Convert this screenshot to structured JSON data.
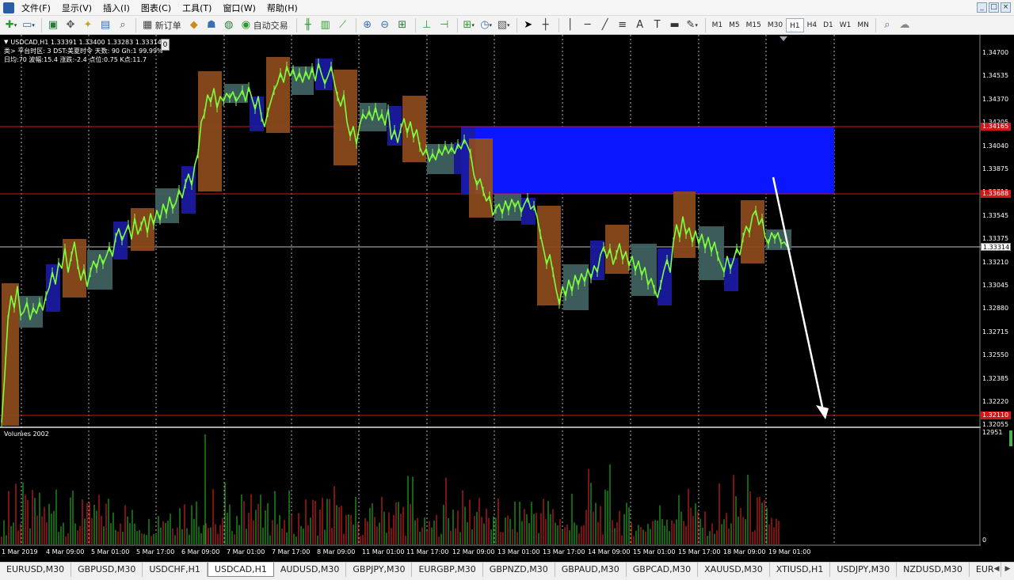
{
  "menu": {
    "items": [
      "文件(F)",
      "显示(V)",
      "插入(I)",
      "图表(C)",
      "工具(T)",
      "窗口(W)",
      "帮助(H)"
    ]
  },
  "window_controls": {
    "minimize": "_",
    "restore": "□",
    "close": "×"
  },
  "toolbar": {
    "new_order_label": "新订单",
    "auto_trade_label": "自动交易",
    "timeframes": [
      "M1",
      "M5",
      "M15",
      "M30",
      "H1",
      "H4",
      "D1",
      "W1",
      "MN"
    ],
    "active_timeframe": "H1"
  },
  "chart": {
    "symbol_line": "USDCAD,H1  1.33391 1.33400 1.33283 1.33314",
    "info_line1": "类> 平台时区: 3  DST:美夏时令  天数: 90  Gh:1  99.99%",
    "info_line2": "日均:70  波幅:15.4  涨跌:-2.4  点位:0.75  K点:11.7",
    "badge": "0",
    "volumes_label": "Volumes 2002",
    "volumes_max": "12951",
    "volumes_zero": "0",
    "price_ticks": [
      "1.34700",
      "1.34535",
      "1.34370",
      "1.34205",
      "1.34040",
      "1.33875",
      "1.33710",
      "1.33545",
      "1.33375",
      "1.33210",
      "1.33045",
      "1.32880",
      "1.32715",
      "1.32550",
      "1.32385",
      "1.32220",
      "1.32055"
    ],
    "price_markers": {
      "upper_zone": "1.34165",
      "lower_zone": "1.33688",
      "current": "1.33314",
      "target": "1.32110"
    },
    "colors": {
      "background": "#000000",
      "candles": "#7cff3c",
      "zone_fill": "#0a16ff",
      "hline": "#d01818",
      "current_line": "#bfbfbf",
      "arrow": "#ffffff",
      "box_up": "#8a4a1c",
      "box_down": "#3f6060",
      "box_blue": "#1a1aa0"
    }
  },
  "time_labels": [
    "1 Mar 2019",
    "4 Mar 09:00",
    "5 Mar 01:00",
    "5 Mar 17:00",
    "6 Mar 09:00",
    "7 Mar 01:00",
    "7 Mar 17:00",
    "8 Mar 09:00",
    "11 Mar 01:00",
    "11 Mar 17:00",
    "12 Mar 09:00",
    "13 Mar 01:00",
    "13 Mar 17:00",
    "14 Mar 09:00",
    "15 Mar 01:00",
    "15 Mar 17:00",
    "18 Mar 09:00",
    "19 Mar 01:00"
  ],
  "tabs": [
    "EURUSD,M30",
    "GBPUSD,M30",
    "USDCHF,H1",
    "USDCAD,H1",
    "AUDUSD,M30",
    "GBPJPY,M30",
    "EURGBP,M30",
    "GBPNZD,M30",
    "GBPAUD,M30",
    "GBPCAD,M30",
    "XAUUSD,M30",
    "XTIUSD,H1",
    "USDJPY,M30",
    "NZDUSD,M30",
    "EUR"
  ],
  "active_tab": "USDCAD,H1",
  "tab_scroll": [
    "◀",
    "▶"
  ]
}
